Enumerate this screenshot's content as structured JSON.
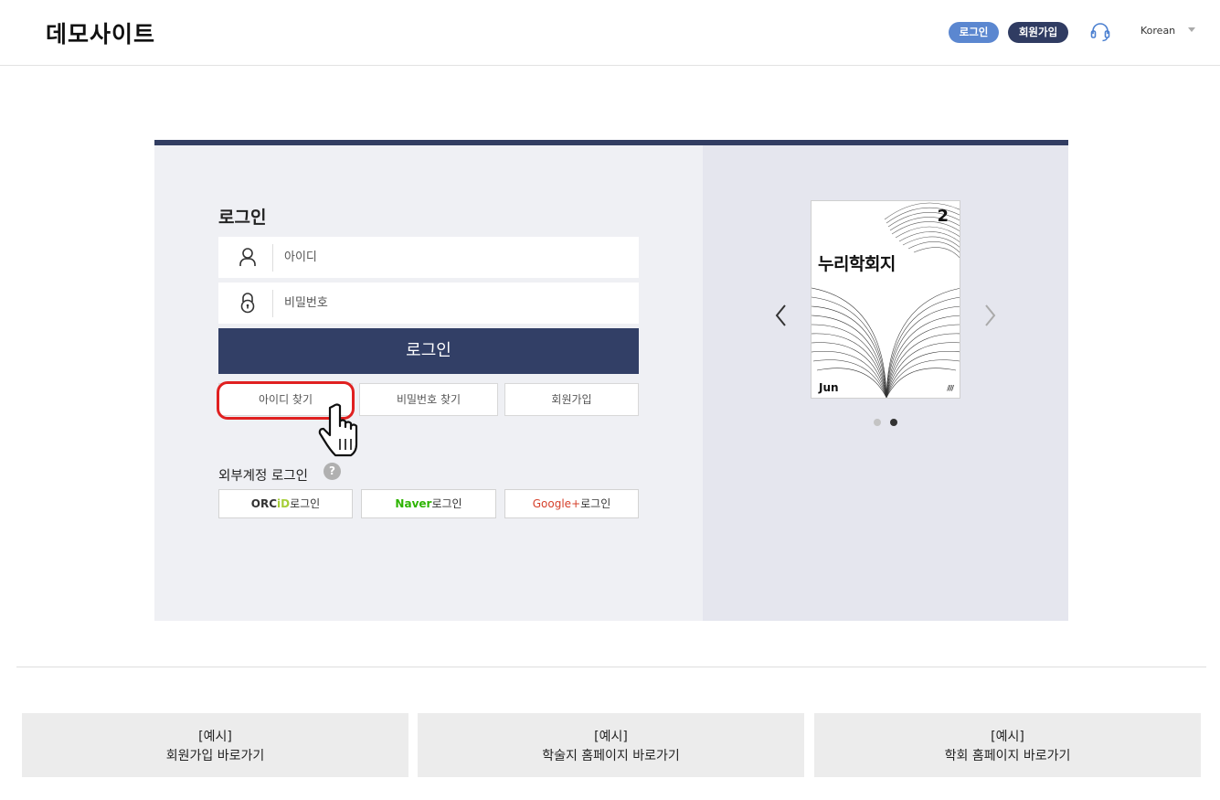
{
  "header": {
    "logo": "데모사이트",
    "login_label": "로그인",
    "join_label": "회원가입",
    "language": "Korean",
    "icons": {
      "support": "headset-icon",
      "language_dropdown": "caret-down-icon"
    }
  },
  "login": {
    "title": "로그인",
    "id_placeholder": "아이디",
    "pw_placeholder": "비밀번호",
    "submit_label": "로그인",
    "find_id_label": "아이디 찾기",
    "find_pw_label": "비밀번호 찾기",
    "join_label": "회원가입",
    "icons": {
      "user": "user-icon",
      "lock": "lock-icon"
    }
  },
  "external": {
    "title": "외부계정 로그인",
    "help": "?",
    "orcid_a": "ORC",
    "orcid_b": "iD",
    "orcid_suffix": "로그인",
    "naver_a": "Naver",
    "naver_suffix": "로그인",
    "google_a": "Google+",
    "google_suffix": "로그인"
  },
  "carousel": {
    "cover_number": "2",
    "cover_title": "누리학회지",
    "cover_month": "Jun",
    "cover_mark": "////",
    "active_slide": 2,
    "total_slides": 2,
    "icons": {
      "prev": "chevron-left-icon",
      "next": "chevron-right-icon"
    }
  },
  "footer": {
    "links": [
      {
        "line1": "[예시]",
        "line2": "회원가입 바로가기"
      },
      {
        "line1": "[예시]",
        "line2": "학술지 홈페이지 바로가기"
      },
      {
        "line1": "[예시]",
        "line2": "학회 홈페이지 바로가기"
      }
    ]
  },
  "colors": {
    "accent_dark": "#323f66",
    "accent_blue": "#5b87d0",
    "highlight": "#e02020",
    "panel_bg": "#eff0f4"
  }
}
